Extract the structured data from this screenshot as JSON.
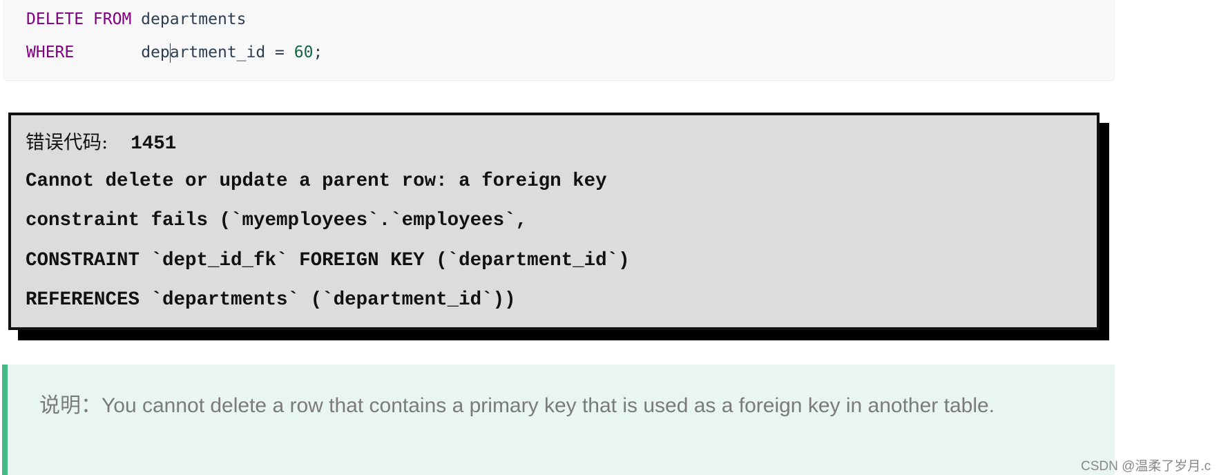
{
  "code": {
    "line1": {
      "kw": "DELETE FROM",
      "rest": " departments"
    },
    "line2": {
      "kw": "WHERE",
      "gap": "       ",
      "before_caret": "dep",
      "after_caret": "artment_id = ",
      "number": "60",
      "end": ";"
    }
  },
  "error": {
    "label": "错误代码:",
    "code": "  1451",
    "lines": [
      "Cannot delete or update a parent row: a foreign key",
      "constraint fails (`myemployees`.`employees`,",
      "CONSTRAINT `dept_id_fk` FOREIGN KEY (`department_id`)",
      "REFERENCES `departments` (`department_id`))"
    ]
  },
  "note": {
    "label": "说明：",
    "text": "You cannot delete a row that contains a primary key that is used as a foreign key in another table."
  },
  "watermark": "CSDN @温柔了岁月.c",
  "colors": {
    "keyword": "#800080",
    "number": "#116644",
    "note_border": "#42b983",
    "note_bg": "#e9f5f1",
    "error_bg": "#dcdcdc"
  }
}
